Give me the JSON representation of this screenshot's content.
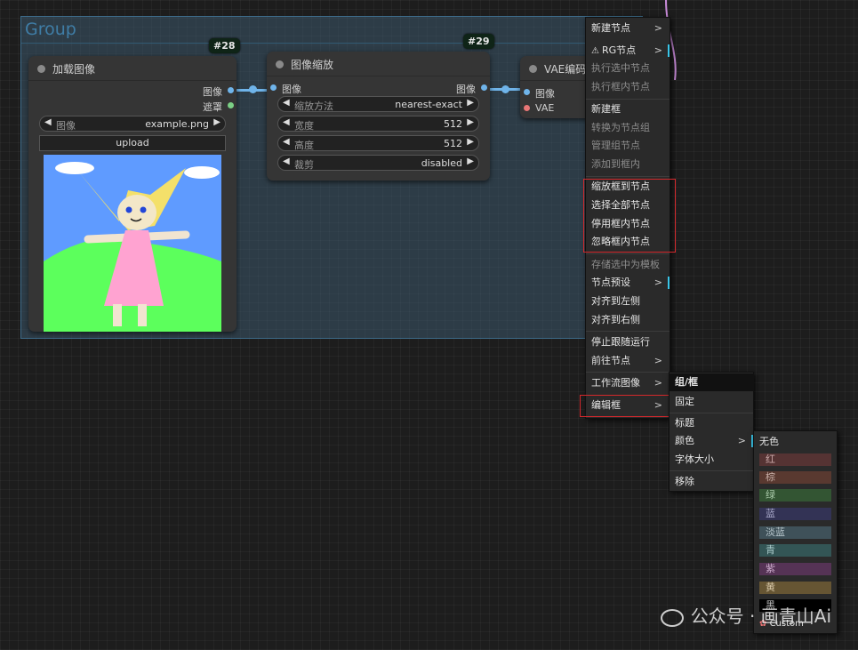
{
  "group": {
    "title": "Group"
  },
  "nodes": {
    "load_image": {
      "badge": "#28",
      "title": "加载图像",
      "outputs": [
        "图像",
        "遮罩"
      ],
      "image_widget": {
        "label": "图像",
        "value": "example.png"
      },
      "upload_label": "upload"
    },
    "scale_image": {
      "badge": "#29",
      "title": "图像缩放",
      "input": "图像",
      "output": "图像",
      "widgets": [
        {
          "label": "缩放方法",
          "value": "nearest-exact"
        },
        {
          "label": "宽度",
          "value": "512"
        },
        {
          "label": "高度",
          "value": "512"
        },
        {
          "label": "裁剪",
          "value": "disabled"
        }
      ]
    },
    "vae_encode": {
      "title": "VAE编码",
      "inputs": [
        "图像",
        "VAE"
      ]
    }
  },
  "context_menu": {
    "items": [
      {
        "label": "新建节点",
        "submenu": true
      },
      {
        "label": "RG节点",
        "submenu": true
      },
      {
        "label": "执行选中节点",
        "disabled": true
      },
      {
        "label": "执行框内节点",
        "disabled": true
      },
      {
        "label": "新建框"
      },
      {
        "label": "转换为节点组",
        "disabled": true
      },
      {
        "label": "管理组节点",
        "disabled": true
      },
      {
        "label": "添加到框内",
        "disabled": true
      },
      {
        "label": "缩放框到节点"
      },
      {
        "label": "选择全部节点"
      },
      {
        "label": "停用框内节点"
      },
      {
        "label": "忽略框内节点"
      },
      {
        "label": "存储选中为模板",
        "disabled": true
      },
      {
        "label": "节点预设",
        "submenu": true
      },
      {
        "label": "对齐到左侧"
      },
      {
        "label": "对齐到右侧"
      },
      {
        "label": "停止跟随运行"
      },
      {
        "label": "前往节点",
        "submenu": true
      },
      {
        "label": "工作流图像",
        "submenu": true
      },
      {
        "label": "编辑框",
        "submenu": true
      }
    ]
  },
  "edit_group_menu": {
    "items": [
      "组/框",
      "固定",
      "标题",
      "颜色",
      "字体大小",
      "移除"
    ]
  },
  "color_menu": {
    "items": [
      {
        "label": "无色",
        "color": ""
      },
      {
        "label": "红",
        "color": "#553333"
      },
      {
        "label": "棕",
        "color": "#593930"
      },
      {
        "label": "绿",
        "color": "#335533"
      },
      {
        "label": "蓝",
        "color": "#333355"
      },
      {
        "label": "淡蓝",
        "color": "#3f5159"
      },
      {
        "label": "青",
        "color": "#335555"
      },
      {
        "label": "紫",
        "color": "#553355"
      },
      {
        "label": "黄",
        "color": "#665533"
      },
      {
        "label": "黑",
        "color": "#000000"
      },
      {
        "label": "Custom",
        "color": ""
      }
    ]
  },
  "watermark": "公众号 · 画青山Ai"
}
